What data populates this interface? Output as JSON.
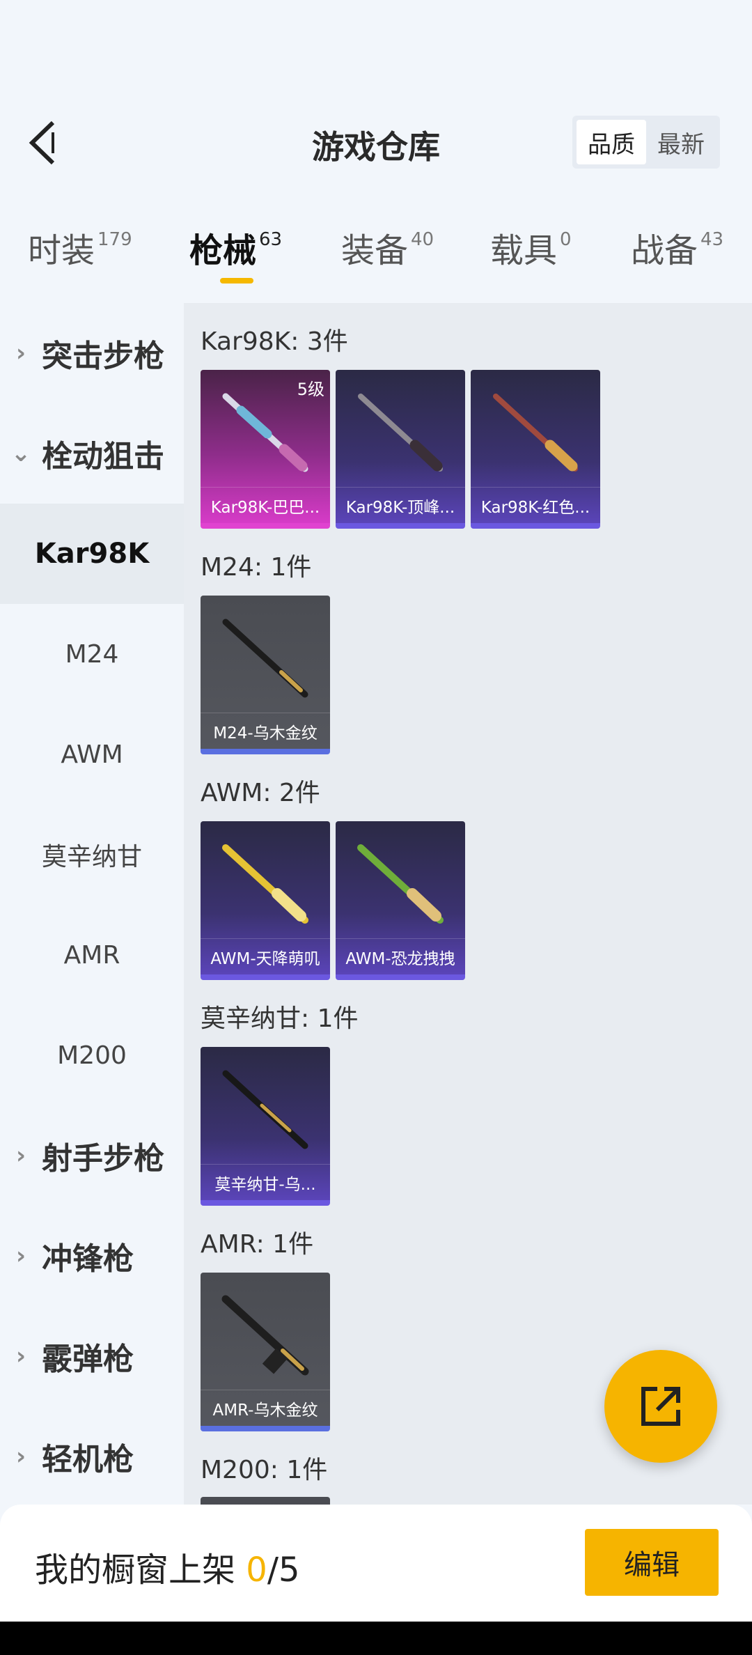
{
  "header": {
    "title": "游戏仓库",
    "sort_options": [
      "品质",
      "最新"
    ],
    "sort_active": "品质"
  },
  "tabs": [
    {
      "label": "时装",
      "count": "179"
    },
    {
      "label": "枪械",
      "count": "63"
    },
    {
      "label": "装备",
      "count": "40"
    },
    {
      "label": "载具",
      "count": "0"
    },
    {
      "label": "战备",
      "count": "43"
    }
  ],
  "sidebar": {
    "categories": [
      "突击步枪",
      "栓动狙击",
      "射手步枪",
      "冲锋枪",
      "霰弹枪",
      "轻机枪"
    ],
    "subitems": [
      "Kar98K",
      "M24",
      "AWM",
      "莫辛纳甘",
      "AMR",
      "M200"
    ],
    "active_sub": "Kar98K"
  },
  "groups": [
    {
      "title": "Kar98K: 3件",
      "items": [
        {
          "name": "Kar98K-巴巴...",
          "rarity": "pink",
          "level": "5级"
        },
        {
          "name": "Kar98K-顶峰...",
          "rarity": "purple"
        },
        {
          "name": "Kar98K-红色...",
          "rarity": "purple"
        }
      ]
    },
    {
      "title": "M24: 1件",
      "items": [
        {
          "name": "M24-乌木金纹",
          "rarity": "gray"
        }
      ]
    },
    {
      "title": "AWM: 2件",
      "items": [
        {
          "name": "AWM-天降萌叽",
          "rarity": "purple"
        },
        {
          "name": "AWM-恐龙拽拽",
          "rarity": "purple"
        }
      ]
    },
    {
      "title": "莫辛纳甘: 1件",
      "items": [
        {
          "name": "莫辛纳甘-乌...",
          "rarity": "purple"
        }
      ]
    },
    {
      "title": "AMR: 1件",
      "items": [
        {
          "name": "AMR-乌木金纹",
          "rarity": "gray"
        }
      ]
    },
    {
      "title": "M200: 1件",
      "items": []
    }
  ],
  "bottom": {
    "showcase_label": "我的橱窗上架",
    "showcase_current": "0",
    "showcase_total": "/5",
    "edit_label": "编辑"
  },
  "colors": {
    "accent": "#f6b400",
    "purple": "#5a44b8",
    "pink": "#d63bc7",
    "gray": "#55575e"
  }
}
